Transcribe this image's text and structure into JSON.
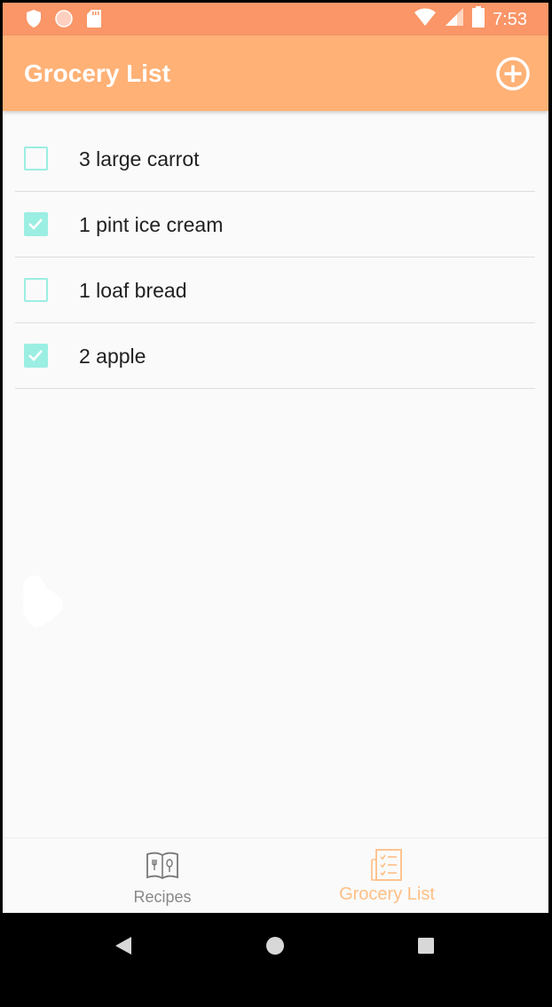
{
  "status_bar": {
    "time": "7:53",
    "left_icons": [
      "shield-icon",
      "circle-icon",
      "sd-card-icon"
    ],
    "right_icons": [
      "wifi-icon",
      "signal-icon",
      "battery-icon"
    ]
  },
  "app_bar": {
    "title": "Grocery List",
    "action_icon": "add-circle-icon"
  },
  "grocery_items": [
    {
      "label": "3 large carrot",
      "checked": false
    },
    {
      "label": "1 pint ice cream",
      "checked": true
    },
    {
      "label": "1 loaf bread",
      "checked": false
    },
    {
      "label": "2 apple",
      "checked": true
    }
  ],
  "bottom_nav": {
    "items": [
      {
        "label": "Recipes",
        "icon": "recipe-book-icon",
        "active": false
      },
      {
        "label": "Grocery List",
        "icon": "checklist-icon",
        "active": true
      }
    ]
  },
  "system_nav": [
    "back-icon",
    "home-icon",
    "recents-icon"
  ],
  "colors": {
    "status_bar": "#fa9668",
    "app_bar": "#ffb176",
    "checkbox_accent": "#9beee2",
    "active_nav": "#ffbf84",
    "inactive_nav": "#888888"
  }
}
